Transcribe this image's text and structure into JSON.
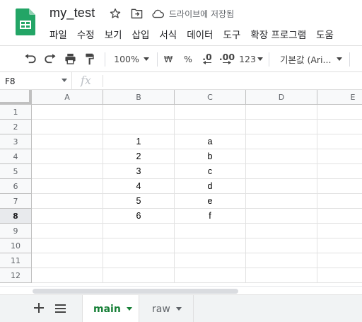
{
  "app": {
    "doc_title": "my_test",
    "save_status": "드라이브에 저장됨"
  },
  "menu": [
    "파일",
    "수정",
    "보기",
    "삽입",
    "서식",
    "데이터",
    "도구",
    "확장 프로그램",
    "도움"
  ],
  "toolbar": {
    "zoom": "100%",
    "currency": "₩",
    "percent": "%",
    "dec_decrease": ".0",
    "dec_increase": ".00",
    "number_format": "123",
    "font": "기본값 (Ari..."
  },
  "formula_bar": {
    "name_box": "F8",
    "fx": "fx",
    "value": ""
  },
  "grid": {
    "columns": [
      "A",
      "B",
      "C",
      "D",
      "E"
    ],
    "rows": [
      "1",
      "2",
      "3",
      "4",
      "5",
      "6",
      "7",
      "8",
      "9",
      "10",
      "11",
      "12"
    ],
    "selected_row": "8",
    "values": {
      "B3": "1",
      "C3": "a",
      "B4": "2",
      "C4": "b",
      "B5": "3",
      "C5": "c",
      "B6": "4",
      "C6": "d",
      "B7": "5",
      "C7": "e",
      "B8": "6",
      "C8": "f"
    }
  },
  "sheets": [
    {
      "label": "main",
      "active": true
    },
    {
      "label": "raw",
      "active": false
    }
  ],
  "colors": {
    "brand_green": "#188038",
    "header_bg": "#f8f9fa",
    "tabbar_bg": "#f1f3f4"
  }
}
